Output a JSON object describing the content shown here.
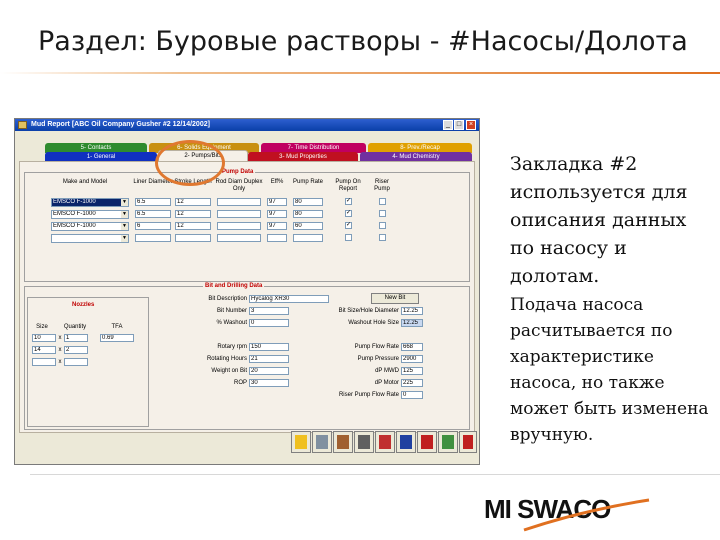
{
  "slide": {
    "title": "Раздел: Буровые растворы - #Насосы/Долота",
    "para1": "Закладка #2 используется для описания данных по насосу и долотам.",
    "para2": "Подача насоса расчитывается по характеристике насоса, но также может быть изменена вручную.",
    "logo": "MI SWACO"
  },
  "window": {
    "title": "Mud Report [ABC Oil Company  Gusher #2  12/14/2002]",
    "controls": [
      "_",
      "□",
      "×"
    ]
  },
  "tabs": {
    "row1": [
      {
        "label": "5- Contacts",
        "color": "#2e8b2e"
      },
      {
        "label": "6- Solids Equipment",
        "color": "#c89010"
      },
      {
        "label": "7- Time Distribution",
        "color": "#c00060"
      },
      {
        "label": "8- Prev./Recap",
        "color": "#e0a000"
      }
    ],
    "row2": [
      {
        "label": "1- General",
        "color": "#1030c0"
      },
      {
        "label": "2- Pumps/Bits",
        "color": "#f5f0e8"
      },
      {
        "label": "3- Mud Properties",
        "color": "#c01020"
      },
      {
        "label": "4- Mud Chemistry",
        "color": "#7030a0"
      }
    ]
  },
  "pump": {
    "section_title": "Pump Data",
    "headers": [
      "Make and Model",
      "Liner Diameter",
      "Stroke Length",
      "Rod Diam Duplex Only",
      "Eff%",
      "Pump Rate",
      "Pump On Report",
      "Riser Pump"
    ],
    "rows": [
      {
        "model": "EMSCO F-1000",
        "liner": "6.5",
        "stroke": "12",
        "rod": "",
        "eff": "97",
        "rate": "80",
        "on_report": "✓",
        "riser": ""
      },
      {
        "model": "EMSCO F-1000",
        "liner": "6.5",
        "stroke": "12",
        "rod": "",
        "eff": "97",
        "rate": "80",
        "on_report": "✓",
        "riser": ""
      },
      {
        "model": "EMSCO F-1000",
        "liner": "6",
        "stroke": "12",
        "rod": "",
        "eff": "97",
        "rate": "60",
        "on_report": "✓",
        "riser": ""
      },
      {
        "model": "",
        "liner": "",
        "stroke": "",
        "rod": "",
        "eff": "",
        "rate": "",
        "on_report": "",
        "riser": ""
      }
    ]
  },
  "bit": {
    "section_title": "Bit and Drilling Data",
    "nozzles_title": "Nozzles",
    "nozzle_headers": [
      "Size",
      "Quantity",
      "TFA"
    ],
    "nozzles": [
      {
        "size": "10",
        "x": "x",
        "qty": "1",
        "tfa": "0.69"
      },
      {
        "size": "14",
        "x": "x",
        "qty": "2",
        "tfa": ""
      },
      {
        "size": "",
        "x": "x",
        "qty": "",
        "tfa": ""
      }
    ],
    "left_fields": [
      {
        "label": "Bit Description",
        "value": "Hycalog XR30"
      },
      {
        "label": "Bit Number",
        "value": "3"
      },
      {
        "label": "% Washout",
        "value": "0"
      }
    ],
    "rotary_fields": [
      {
        "label": "Rotary rpm",
        "value": "150"
      },
      {
        "label": "Rotating Hours",
        "value": "21"
      },
      {
        "label": "Weight on Bit",
        "value": "20"
      },
      {
        "label": "ROP",
        "value": "30"
      }
    ],
    "right_fields": [
      {
        "label": "Bit Size/Hole Diameter",
        "value": "12.25"
      },
      {
        "label": "Washout Hole Size",
        "value": "12.25"
      }
    ],
    "pump_fields": [
      {
        "label": "Pump Flow Rate",
        "value": "668"
      },
      {
        "label": "Pump Pressure",
        "value": "2900"
      },
      {
        "label": "dP MWD",
        "value": "125"
      },
      {
        "label": "dP Motor",
        "value": "225"
      },
      {
        "label": "Riser Pump Flow Rate",
        "value": "0"
      }
    ],
    "new_bit_label": "New Bit"
  },
  "toolbar": {
    "buttons": [
      "help-icon",
      "print-icon",
      "report-icon",
      "calculator-icon",
      "copy-icon",
      "save-icon",
      "grid-icon",
      "grid-data-icon",
      "exit-icon"
    ]
  }
}
